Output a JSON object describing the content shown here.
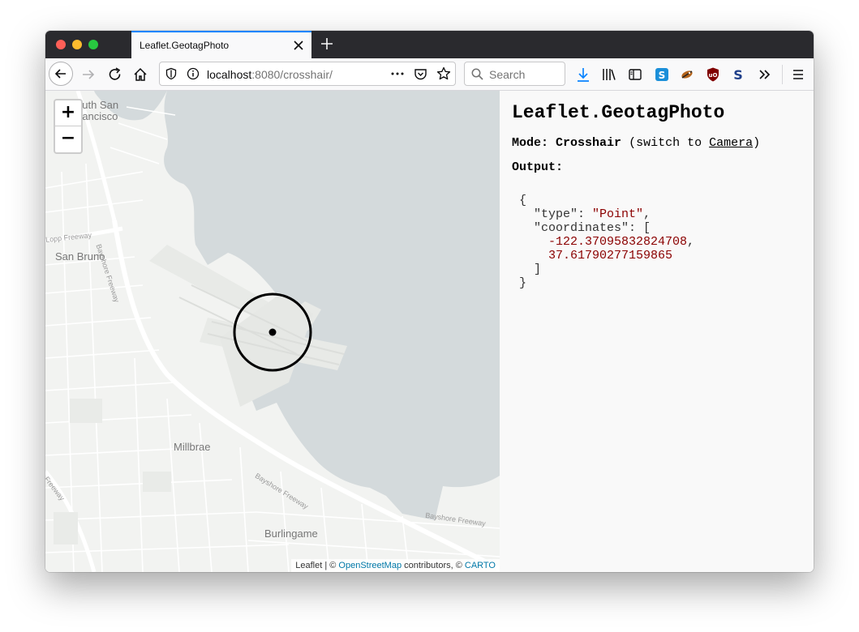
{
  "browser": {
    "tab_title": "Leaflet.GeotagPhoto",
    "url_host": "localhost",
    "url_rest": ":8080/crosshair/",
    "search_placeholder": "Search",
    "icons": [
      "back-icon",
      "forward-icon",
      "reload-icon",
      "home-icon",
      "shield-icon",
      "info-icon",
      "more-icon",
      "pocket-icon",
      "bookmark-star-icon",
      "search-icon",
      "download-icon",
      "library-icon",
      "sidebar-icon",
      "extension-s-icon",
      "extension-bird-icon",
      "ublock-icon",
      "extension-s2-icon",
      "overflow-icon",
      "menu-icon"
    ]
  },
  "map": {
    "zoom_in": "+",
    "zoom_out": "−",
    "places": {
      "south_sf_1": "outh San",
      "south_sf_2": "rancisco",
      "san_bruno": "San Bruno",
      "millbrae": "Millbrae",
      "burlingame": "Burlingame"
    },
    "roads": {
      "bayshore1": "Bayshore Freeway",
      "bayshore2": "Bayshore Freeway",
      "bayshore3": "Bayshore Freeway",
      "bayshore4": "Bayshore Freeway",
      "lopp": "Lopp Freeway",
      "ra": "ra Freeway"
    },
    "attribution": {
      "leaflet": "Leaflet",
      "sep": " | © ",
      "osm": "OpenStreetMap",
      "contrib": " contributors, © ",
      "carto": "CARTO"
    },
    "colors": {
      "water": "#d4dadc",
      "land": "#f2f3f1",
      "road": "#ffffff"
    }
  },
  "panel": {
    "title": "Leaflet.GeotagPhoto",
    "mode_label": "Mode:",
    "mode_value": "Crosshair",
    "switch_prefix": "(switch to ",
    "switch_link": "Camera",
    "switch_suffix": ")",
    "output_label": "Output:",
    "json": {
      "open": "{",
      "type_key": "\"type\"",
      "type_value": "\"Point\"",
      "coords_key": "\"coordinates\"",
      "lon": "-122.37095832824708",
      "lat": "37.61790277159865",
      "close_bracket": "]",
      "close": "}"
    }
  }
}
